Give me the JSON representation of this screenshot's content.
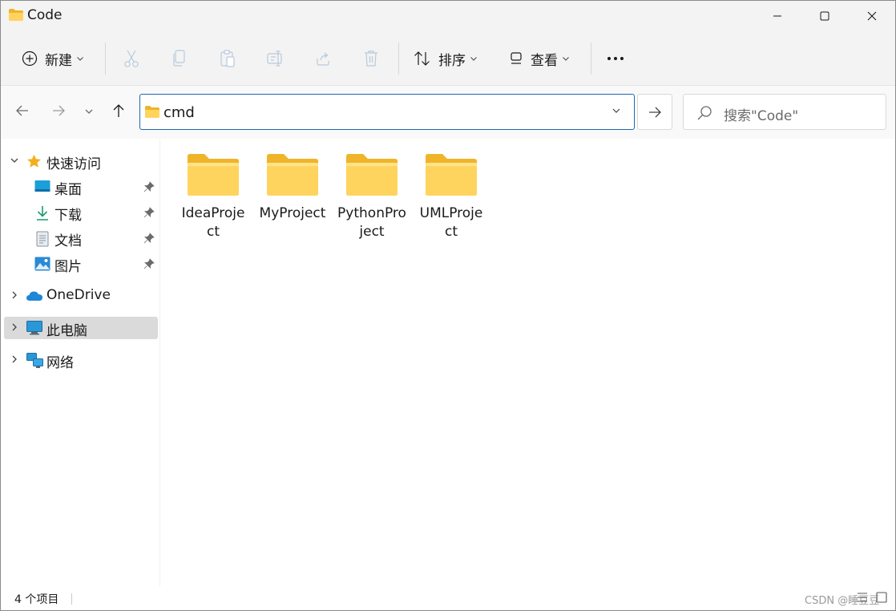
{
  "window": {
    "title": "Code",
    "controls": [
      "minimize-icon",
      "maximize-icon",
      "close-icon"
    ]
  },
  "toolbar": {
    "new_label": "新建",
    "sort_label": "排序",
    "view_label": "查看",
    "more_label": "···",
    "icons": [
      "add-circle-icon",
      "cut-icon",
      "copy-icon",
      "paste-icon",
      "rename-icon",
      "share-icon",
      "delete-icon",
      "sort-icon",
      "view-icon",
      "more-icon"
    ]
  },
  "address": {
    "path": "cmd",
    "search_placeholder": "搜索\"Code\""
  },
  "sidebar": {
    "quick_access": {
      "label": "快速访问",
      "items": [
        {
          "label": "桌面",
          "icon": "desktop-icon"
        },
        {
          "label": "下载",
          "icon": "download-icon"
        },
        {
          "label": "文档",
          "icon": "document-icon"
        },
        {
          "label": "图片",
          "icon": "picture-icon"
        }
      ]
    },
    "onedrive_label": "OneDrive",
    "thispc_label": "此电脑",
    "network_label": "网络"
  },
  "content": {
    "folders": [
      {
        "name": "IdeaProject"
      },
      {
        "name": "MyProject"
      },
      {
        "name": "PythonProject"
      },
      {
        "name": "UMLProject"
      }
    ]
  },
  "status": {
    "item_count": "4 个项目",
    "watermark": "CSDN @睡豆豆"
  },
  "colors": {
    "accent": "#1f67b1",
    "folder_back": "#f0b429",
    "folder_front": "#ffd45e",
    "star": "#f2b01e"
  }
}
